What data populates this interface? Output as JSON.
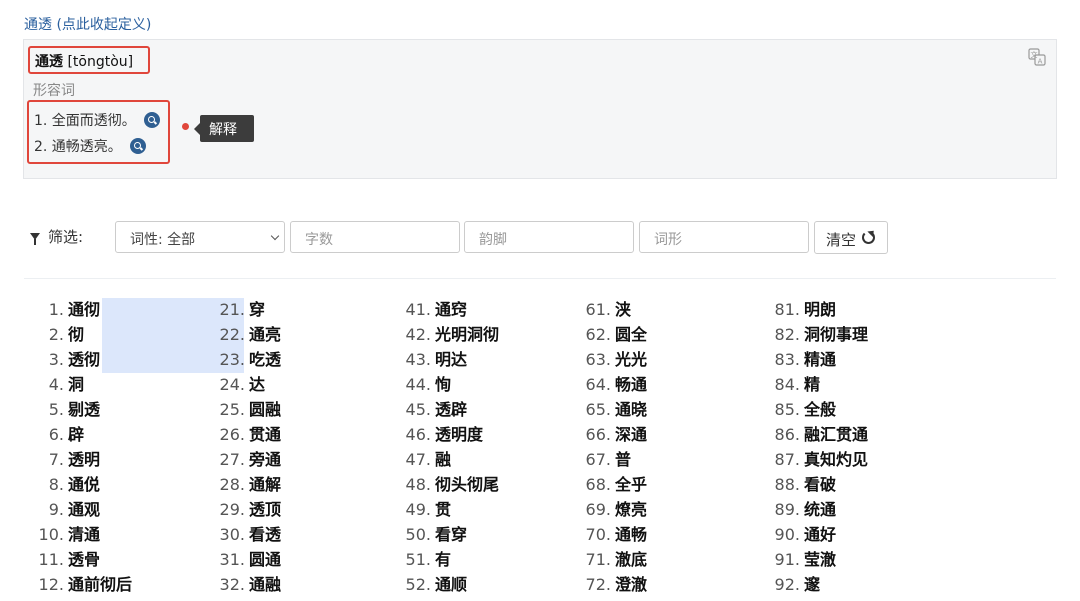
{
  "definition": {
    "toggle_text": "通透 (点此收起定义)",
    "headword": "通透",
    "pinyin": "[tōngtòu]",
    "part_of_speech": "形容词",
    "senses": [
      "1. 全面而透彻。",
      "2. 通畅透亮。"
    ],
    "callout_label": "解释",
    "translate_icon": "translate-icon"
  },
  "filter": {
    "label": "筛选:",
    "pos_select": "词性: 全部",
    "char_count_placeholder": "字数",
    "rhyme_placeholder": "韵脚",
    "form_placeholder": "词形",
    "clear_label": "清空"
  },
  "results": {
    "columns": [
      [
        {
          "num": "1.",
          "word": "通彻"
        },
        {
          "num": "2.",
          "word": "彻"
        },
        {
          "num": "3.",
          "word": "透彻"
        },
        {
          "num": "4.",
          "word": "洞"
        },
        {
          "num": "5.",
          "word": "剔透"
        },
        {
          "num": "6.",
          "word": "辟"
        },
        {
          "num": "7.",
          "word": "透明"
        },
        {
          "num": "8.",
          "word": "通侻"
        },
        {
          "num": "9.",
          "word": "通观"
        },
        {
          "num": "10.",
          "word": "清通"
        },
        {
          "num": "11.",
          "word": "透骨"
        },
        {
          "num": "12.",
          "word": "通前彻后"
        }
      ],
      [
        {
          "num": "21.",
          "word": "穿"
        },
        {
          "num": "22.",
          "word": "通亮"
        },
        {
          "num": "23.",
          "word": "吃透"
        },
        {
          "num": "24.",
          "word": "达"
        },
        {
          "num": "25.",
          "word": "圆融"
        },
        {
          "num": "26.",
          "word": "贯通"
        },
        {
          "num": "27.",
          "word": "旁通"
        },
        {
          "num": "28.",
          "word": "通解"
        },
        {
          "num": "29.",
          "word": "透顶"
        },
        {
          "num": "30.",
          "word": "看透"
        },
        {
          "num": "31.",
          "word": "圆通"
        },
        {
          "num": "32.",
          "word": "通融"
        }
      ],
      [
        {
          "num": "41.",
          "word": "通窍"
        },
        {
          "num": "42.",
          "word": "光明洞彻"
        },
        {
          "num": "43.",
          "word": "明达"
        },
        {
          "num": "44.",
          "word": "恂"
        },
        {
          "num": "45.",
          "word": "透辟"
        },
        {
          "num": "46.",
          "word": "透明度"
        },
        {
          "num": "47.",
          "word": "融"
        },
        {
          "num": "48.",
          "word": "彻头彻尾"
        },
        {
          "num": "49.",
          "word": "贯"
        },
        {
          "num": "50.",
          "word": "看穿"
        },
        {
          "num": "51.",
          "word": "有"
        },
        {
          "num": "52.",
          "word": "通顺"
        }
      ],
      [
        {
          "num": "61.",
          "word": "浃"
        },
        {
          "num": "62.",
          "word": "圆全"
        },
        {
          "num": "63.",
          "word": "光光"
        },
        {
          "num": "64.",
          "word": "畅通"
        },
        {
          "num": "65.",
          "word": "通晓"
        },
        {
          "num": "66.",
          "word": "深通"
        },
        {
          "num": "67.",
          "word": "普"
        },
        {
          "num": "68.",
          "word": "全乎"
        },
        {
          "num": "69.",
          "word": "燎亮"
        },
        {
          "num": "70.",
          "word": "通畅"
        },
        {
          "num": "71.",
          "word": "澈底"
        },
        {
          "num": "72.",
          "word": "澄澈"
        }
      ],
      [
        {
          "num": "81.",
          "word": "明朗"
        },
        {
          "num": "82.",
          "word": "洞彻事理"
        },
        {
          "num": "83.",
          "word": "精通"
        },
        {
          "num": "84.",
          "word": "精"
        },
        {
          "num": "85.",
          "word": "全般"
        },
        {
          "num": "86.",
          "word": "融汇贯通"
        },
        {
          "num": "87.",
          "word": "真知灼见"
        },
        {
          "num": "88.",
          "word": "看破"
        },
        {
          "num": "89.",
          "word": "统通"
        },
        {
          "num": "90.",
          "word": "通好"
        },
        {
          "num": "91.",
          "word": "莹澈"
        },
        {
          "num": "92.",
          "word": "邃"
        }
      ]
    ],
    "highlighted": [
      "1.",
      "2.",
      "3."
    ]
  }
}
